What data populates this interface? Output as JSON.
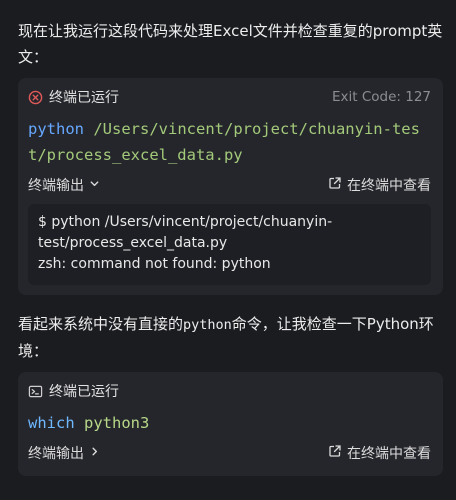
{
  "intro_text": "现在让我运行这段代码来处理Excel文件并检查重复的prompt英文：",
  "card1": {
    "status": "终端已运行",
    "exit_code": "Exit Code: 127",
    "cmd_keyword": "python",
    "cmd_arg": "/Users/vincent/project/chuanyin-test/process_excel_data.py",
    "output_label": "终端输出",
    "open_terminal": "在终端中查看",
    "output_lines": [
      "$ python /Users/vincent/project/chuanyin-test/process_excel_data.py",
      "zsh: command not found: python"
    ]
  },
  "middle_text": {
    "prefix": "看起来系统中没有直接的",
    "code": "python",
    "suffix": "命令，让我检查一下Python环境："
  },
  "card2": {
    "status": "终端已运行",
    "cmd_keyword": "which",
    "cmd_arg": "python3",
    "output_label": "终端输出",
    "open_terminal": "在终端中查看"
  },
  "colors": {
    "error": "#e05a5a",
    "keyword": "#66a8ff",
    "argument": "#a3c97a"
  }
}
